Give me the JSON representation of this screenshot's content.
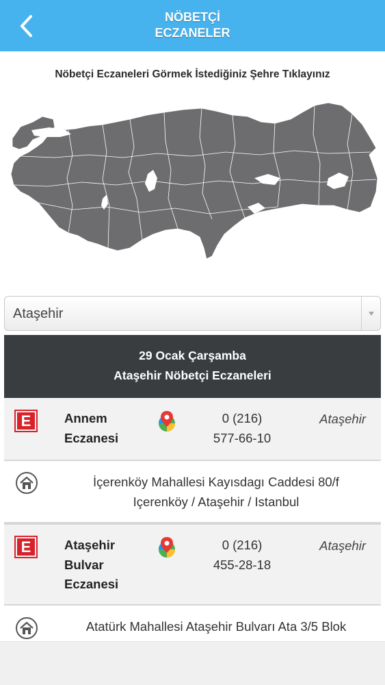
{
  "header": {
    "title_line1": "NÖBETÇİ",
    "title_line2": "ECZANELER",
    "back_icon": "chevron-left-icon",
    "background_color": "#47b3ee"
  },
  "map": {
    "title": "Nöbetçi Eczaneleri Görmek İstediğiniz Şehre Tıklayınız",
    "fill_color": "#6d6d6f"
  },
  "city_select": {
    "selected": "Ataşehir"
  },
  "list_header": {
    "date": "29 Ocak Çarşamba",
    "subtitle": "Ataşehir Nöbetçi Eczaneleri"
  },
  "pharmacies": [
    {
      "name_lines": [
        "Annem",
        "Eczanesi"
      ],
      "phone_lines": [
        "0 (216)",
        "577-66-10"
      ],
      "district": "Ataşehir",
      "address_lines": [
        "İçerenköy Mahallesi Kayısdagı Caddesi 80/f",
        "Içerenköy / Ataşehir / Istanbul"
      ]
    },
    {
      "name_lines": [
        "Ataşehir",
        "Bulvar",
        "Eczanesi"
      ],
      "phone_lines": [
        "0 (216)",
        "455-28-18"
      ],
      "district": "Ataşehir",
      "address_lines": [
        "Atatürk Mahallesi Ataşehir Bulvarı Ata 3/5 Blok"
      ]
    }
  ],
  "icons": {
    "pharmacy": "pharmacy-e-icon",
    "map_pin": "map-pin-icon",
    "home": "home-icon"
  },
  "colors": {
    "pharmacy_red": "#d8222a",
    "list_header_bg": "#393d40"
  }
}
